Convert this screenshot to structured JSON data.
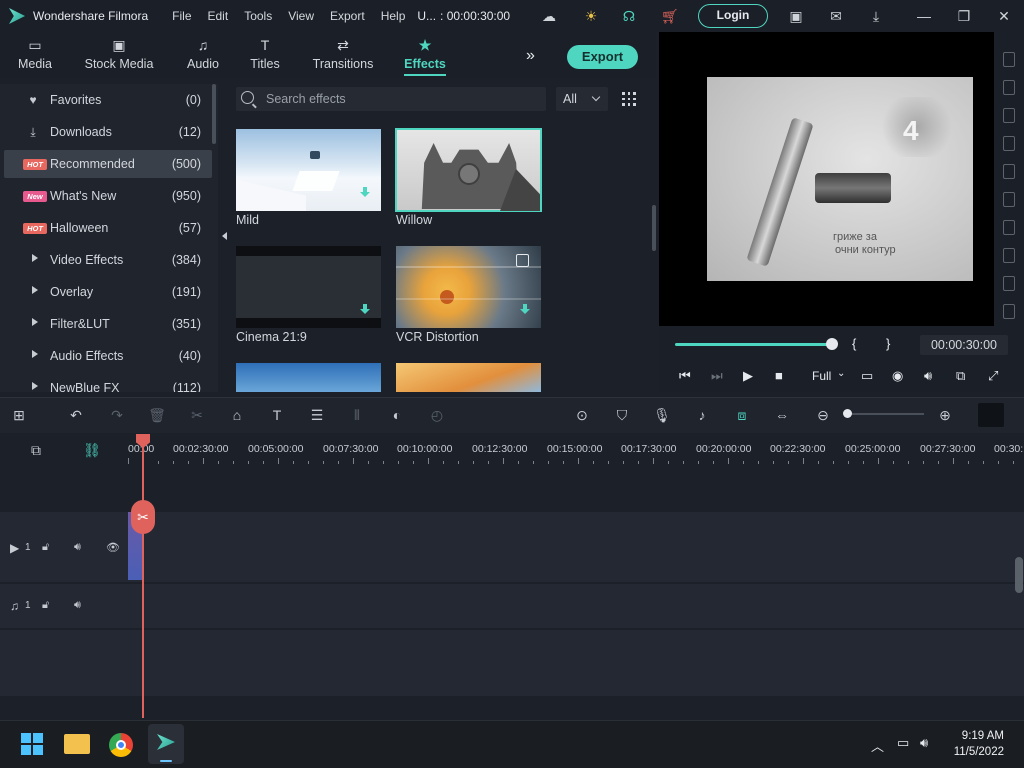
{
  "app": {
    "name": "Wondershare Filmora",
    "menu": [
      "File",
      "Edit",
      "Tools",
      "View",
      "Export",
      "Help"
    ],
    "project_title": "U...",
    "duration": ": 00:00:30:00",
    "login_label": "Login"
  },
  "tabs": [
    {
      "label": "Media",
      "icon": "folder-icon"
    },
    {
      "label": "Stock Media",
      "icon": "stock-media-icon"
    },
    {
      "label": "Audio",
      "icon": "music-note-icon"
    },
    {
      "label": "Titles",
      "icon": "text-t-icon"
    },
    {
      "label": "Transitions",
      "icon": "transition-icon"
    },
    {
      "label": "Effects",
      "icon": "effects-star-icon",
      "active": true
    }
  ],
  "export_label": "Export",
  "sidebar": {
    "items": [
      {
        "label": "Favorites",
        "count": "(0)",
        "icon": "heart-icon"
      },
      {
        "label": "Downloads",
        "count": "(12)",
        "icon": "download-icon"
      },
      {
        "label": "Recommended",
        "count": "(500)",
        "badge": "HOT",
        "active": true
      },
      {
        "label": "What's New",
        "count": "(950)",
        "badge": "New"
      },
      {
        "label": "Halloween",
        "count": "(57)",
        "badge": "HOT"
      },
      {
        "label": "Video Effects",
        "count": "(384)"
      },
      {
        "label": "Overlay",
        "count": "(191)"
      },
      {
        "label": "Filter&LUT",
        "count": "(351)"
      },
      {
        "label": "Audio Effects",
        "count": "(40)"
      },
      {
        "label": "NewBlue FX",
        "count": "(112)"
      }
    ]
  },
  "search": {
    "placeholder": "Search effects"
  },
  "filter": {
    "selected": "All"
  },
  "effects": [
    {
      "label": "Mild",
      "downloadable": true
    },
    {
      "label": "Willow",
      "selected": true
    },
    {
      "label": "Cinema 21:9",
      "downloadable": true
    },
    {
      "label": "VCR Distortion",
      "downloadable": true
    }
  ],
  "preview": {
    "overlay_number": "4",
    "overlay_text_line1": "гриже за",
    "overlay_text_line2": "очни контур",
    "timecode": "00:00:30:00",
    "quality": "Full",
    "progress": 1.0
  },
  "ruler": {
    "labels": [
      "00:00",
      "00:02:30:00",
      "00:05:00:00",
      "00:07:30:00",
      "00:10:00:00",
      "00:12:30:00",
      "00:15:00:00",
      "00:17:30:00",
      "00:20:00:00",
      "00:22:30:00",
      "00:25:00:00",
      "00:27:30:00",
      "00:30:"
    ]
  },
  "tracks": {
    "video_label": "1",
    "audio_label": "1"
  },
  "taskbar": {
    "time": "9:19 AM",
    "date": "11/5/2022"
  },
  "colors": {
    "accent": "#4fd6c1",
    "playhead": "#e0625d",
    "hot_badge": "#e8685f",
    "new_badge": "#e85a8e"
  }
}
